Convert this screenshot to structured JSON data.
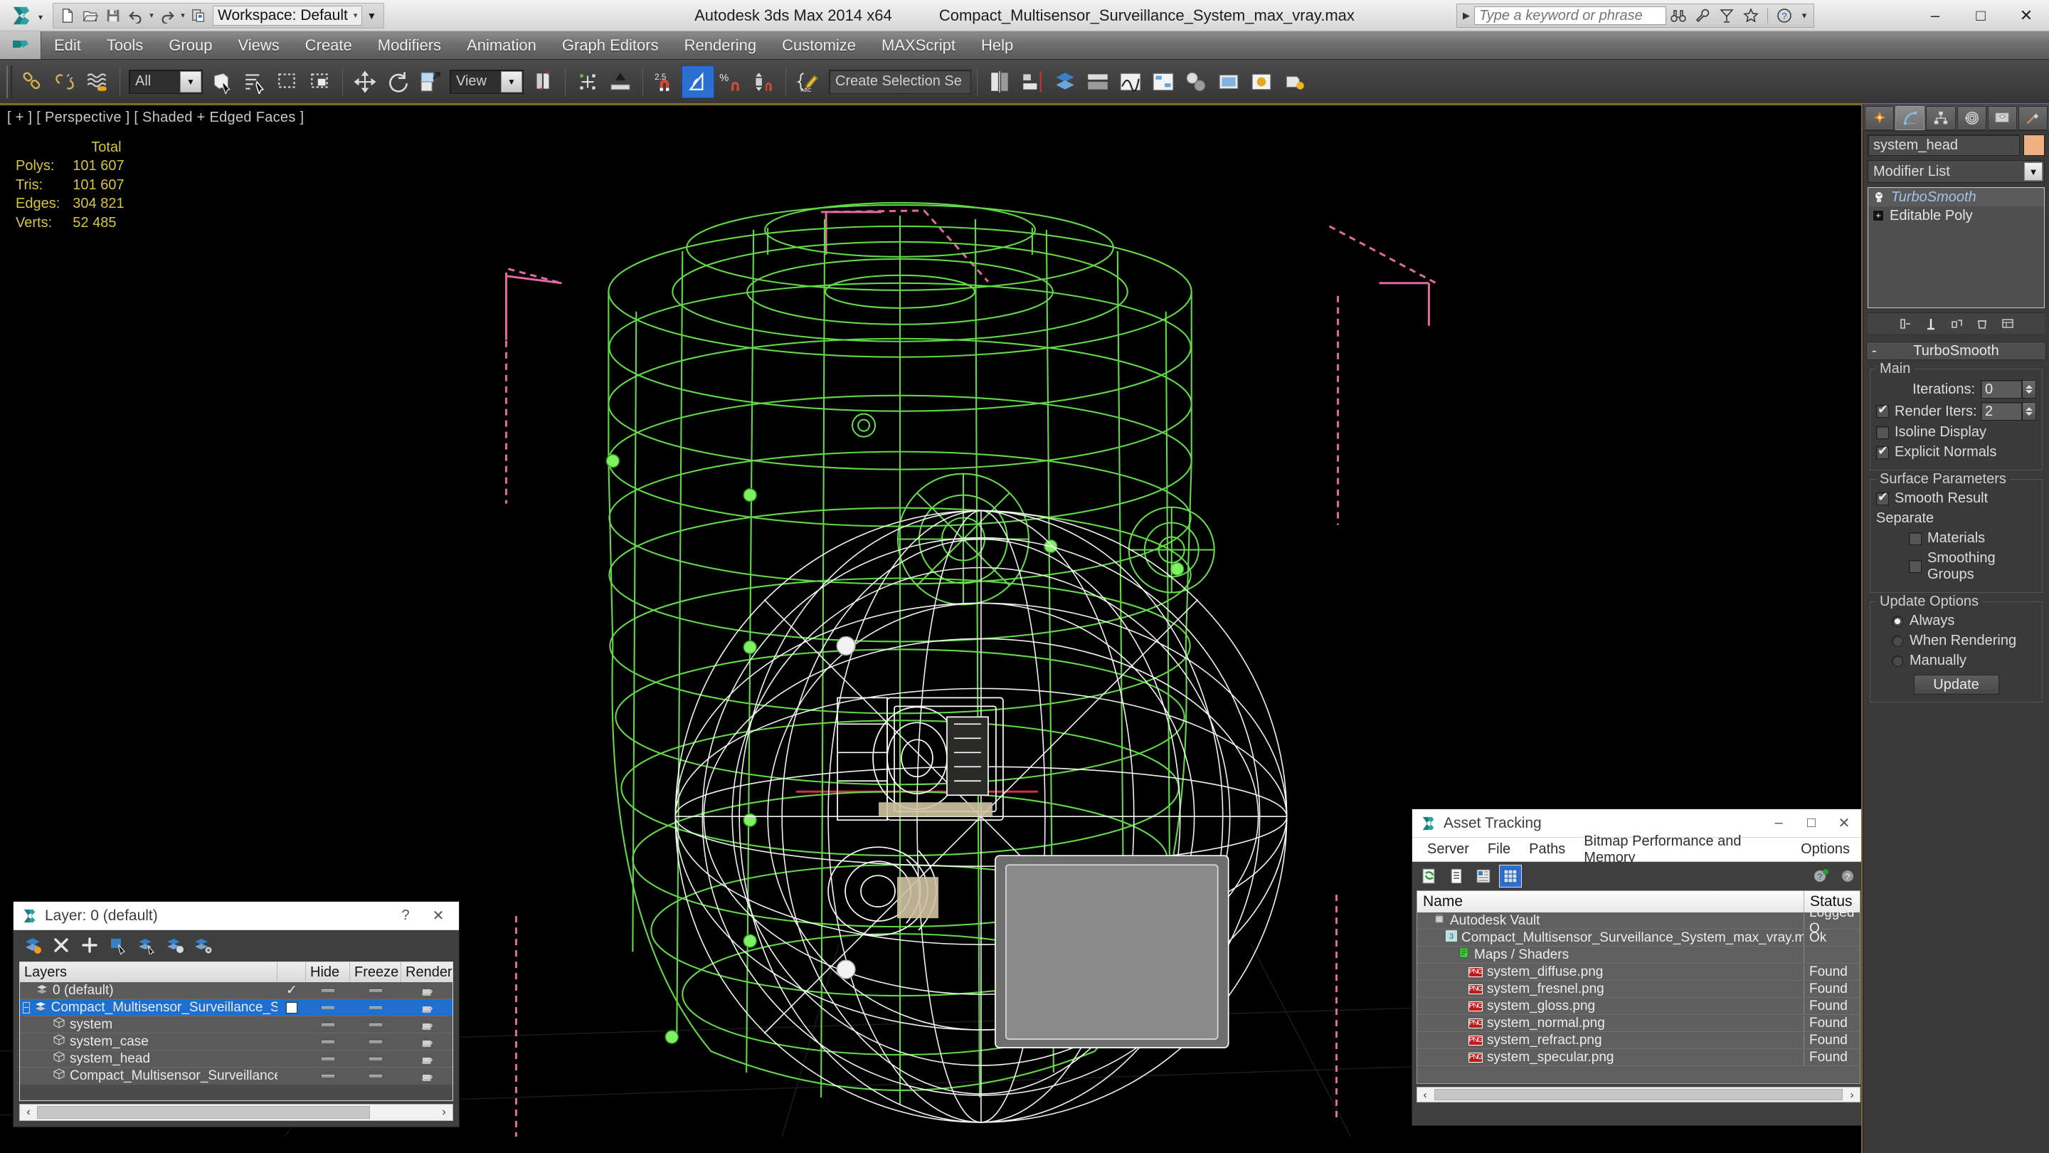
{
  "titlebar": {
    "app_title": "Autodesk 3ds Max  2014 x64",
    "file_title": "Compact_Multisensor_Surveillance_System_max_vray.max",
    "workspace_label": "Workspace: Default",
    "search_placeholder": "Type a keyword or phrase",
    "minimize": "–",
    "maximize": "□",
    "close": "✕"
  },
  "menubar": {
    "items": [
      "Edit",
      "Tools",
      "Group",
      "Views",
      "Create",
      "Modifiers",
      "Animation",
      "Graph Editors",
      "Rendering",
      "Customize",
      "MAXScript",
      "Help"
    ]
  },
  "toolbar": {
    "selection_filter": "All",
    "reference_coord": "View",
    "named_selection_sets": "Create Selection Se",
    "snap_value": "2.5",
    "percent_label": "%"
  },
  "viewport": {
    "label": "[ + ] [ Perspective ] [ Shaded + Edged Faces ]",
    "stats_header": "Total",
    "stats": [
      {
        "key": "Polys:",
        "value": "101 607"
      },
      {
        "key": "Tris:",
        "value": "101 607"
      },
      {
        "key": "Edges:",
        "value": "304 821"
      },
      {
        "key": "Verts:",
        "value": "52 485"
      }
    ]
  },
  "command_panel": {
    "object_name": "system_head",
    "modifier_list_label": "Modifier List",
    "stack": [
      {
        "label": "TurboSmooth",
        "selected": true
      },
      {
        "label": "Editable Poly",
        "selected": false
      }
    ],
    "rollout_title": "TurboSmooth",
    "rollout_mark": "-",
    "groups": {
      "main_label": "Main",
      "iterations_label": "Iterations:",
      "iterations_value": "0",
      "render_iters_label": "Render Iters:",
      "render_iters_value": "2",
      "isoline_display_label": "Isoline Display",
      "explicit_normals_label": "Explicit Normals",
      "surface_params_label": "Surface Parameters",
      "smooth_result_label": "Smooth Result",
      "separate_label": "Separate",
      "materials_label": "Materials",
      "smoothing_groups_label": "Smoothing Groups",
      "update_options_label": "Update Options",
      "always_label": "Always",
      "when_rendering_label": "When Rendering",
      "manually_label": "Manually",
      "update_button": "Update"
    }
  },
  "layer_dialog": {
    "title": "Layer: 0 (default)",
    "help_btn": "?",
    "close_btn": "✕",
    "columns": [
      "Layers",
      "",
      "Hide",
      "Freeze",
      "Render"
    ],
    "rows": [
      {
        "name": "0 (default)",
        "indent": 1,
        "current": "✓",
        "selected": false,
        "expander": ""
      },
      {
        "name": "Compact_Multisensor_Surveillance_System",
        "indent": 0,
        "current": "",
        "selected": true,
        "expander": "−"
      },
      {
        "name": "system",
        "indent": 2,
        "current": "",
        "selected": false,
        "expander": ""
      },
      {
        "name": "system_case",
        "indent": 2,
        "current": "",
        "selected": false,
        "expander": ""
      },
      {
        "name": "system_head",
        "indent": 2,
        "current": "",
        "selected": false,
        "expander": ""
      },
      {
        "name": "Compact_Multisensor_Surveillance_System",
        "indent": 2,
        "current": "",
        "selected": false,
        "expander": ""
      }
    ],
    "scroll_left": "‹",
    "scroll_right": "›"
  },
  "asset_tracking": {
    "title": "Asset Tracking",
    "minimize": "–",
    "maximize": "□",
    "close": "✕",
    "menu": [
      "Server",
      "File",
      "Paths",
      "Bitmap Performance and Memory",
      "Options"
    ],
    "columns": [
      "Name",
      "Status"
    ],
    "rows": [
      {
        "name": "Autodesk Vault",
        "status": "Logged O",
        "icon": "vault",
        "indent": 1
      },
      {
        "name": "Compact_Multisensor_Surveillance_System_max_vray.max",
        "status": "Ok",
        "icon": "max",
        "indent": 2
      },
      {
        "name": "Maps / Shaders",
        "status": "",
        "icon": "maps",
        "indent": 3
      },
      {
        "name": "system_diffuse.png",
        "status": "Found",
        "icon": "png",
        "indent": 4
      },
      {
        "name": "system_fresnel.png",
        "status": "Found",
        "icon": "png",
        "indent": 4
      },
      {
        "name": "system_gloss.png",
        "status": "Found",
        "icon": "png",
        "indent": 4
      },
      {
        "name": "system_normal.png",
        "status": "Found",
        "icon": "png",
        "indent": 4
      },
      {
        "name": "system_refract.png",
        "status": "Found",
        "icon": "png",
        "indent": 4
      },
      {
        "name": "system_specular.png",
        "status": "Found",
        "icon": "png",
        "indent": 4
      }
    ],
    "scroll_left": "‹",
    "scroll_right": "›"
  },
  "colors": {
    "accent_blue": "#2b6fd4",
    "stats_yellow": "#d6c63a",
    "wire_green": "#66e04a",
    "wire_white": "#ffffff",
    "gizmo_pink": "#e06aa0",
    "viewport_border": "#7a6a2a",
    "object_swatch": "#efb184"
  }
}
